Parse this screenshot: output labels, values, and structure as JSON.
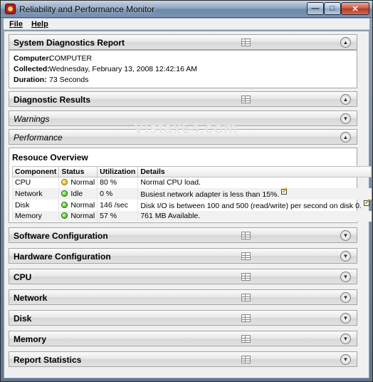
{
  "window": {
    "title": "Reliability and Performance Monitor",
    "controls": {
      "minimize": "—",
      "maximize": "□",
      "close": "✕"
    }
  },
  "menu": {
    "items": [
      "File",
      "Help"
    ]
  },
  "report": {
    "title": "System Diagnostics Report",
    "computer_label": "Computer:",
    "computer": "COMPUTER",
    "collected_label": "Collected:",
    "collected": "Wednesday, February 13, 2008 12:42:16 AM",
    "duration_label": "Duration:",
    "duration": "73 Seconds"
  },
  "sections": {
    "diagnostic_results": "Diagnostic Results",
    "warnings": "Warnings",
    "performance": "Performance"
  },
  "watermark": "Vistax64.com",
  "resource_overview": {
    "title": "Resouce Overview",
    "columns": [
      "Component",
      "Status",
      "Utilization",
      "Details"
    ],
    "rows": [
      {
        "component": "CPU",
        "status": "Normal",
        "status_color": "yellow",
        "utilization": "80 %",
        "details": "Normal CPU load.",
        "note": false
      },
      {
        "component": "Network",
        "status": "Idle",
        "status_color": "green",
        "utilization": "0 %",
        "details": "Busiest network adapter is less than 15%.",
        "note": true
      },
      {
        "component": "Disk",
        "status": "Normal",
        "status_color": "green",
        "utilization": "146 /sec",
        "details": "Disk I/O is between 100 and 500 (read/write) per second on disk 0.",
        "note": true
      },
      {
        "component": "Memory",
        "status": "Normal",
        "status_color": "green",
        "utilization": "57 %",
        "details": "761 MB Available.",
        "note": false
      }
    ]
  },
  "collapsed_sections": [
    "Software Configuration",
    "Hardware Configuration",
    "CPU",
    "Network",
    "Disk",
    "Memory",
    "Report Statistics"
  ],
  "icons": {
    "expand": "chevron-down-icon",
    "collapse": "chevron-up-icon",
    "table_view": "table-view-icon"
  }
}
